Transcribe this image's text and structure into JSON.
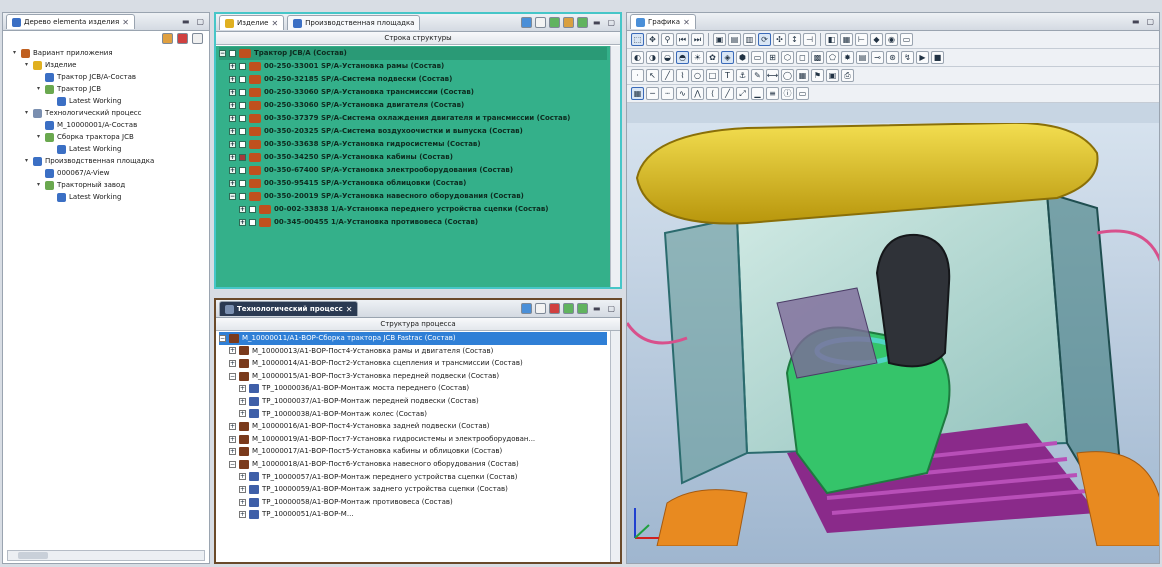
{
  "left_panel": {
    "tab_label": "Дерево elementa изделия",
    "tree": [
      {
        "level": 0,
        "label": "Вариант приложения",
        "expander": "▾",
        "color": "#c06020"
      },
      {
        "level": 1,
        "label": "Изделие",
        "expander": "▾",
        "color": "#e0b020"
      },
      {
        "level": 2,
        "label": "Трактор JCB/A-Состав",
        "expander": "",
        "color": "#3b6fc4"
      },
      {
        "level": 2,
        "label": "Трактор JCB",
        "expander": "▾",
        "color": "#6aa84f"
      },
      {
        "level": 3,
        "label": "Latest Working",
        "expander": "",
        "color": "#3b6fc4"
      },
      {
        "level": 1,
        "label": "Технологический процесс",
        "expander": "▾",
        "color": "#7a8fb0"
      },
      {
        "level": 2,
        "label": "M_10000001/A-Состав",
        "expander": "",
        "color": "#3b6fc4"
      },
      {
        "level": 2,
        "label": "Сборка трактора JCB",
        "expander": "▾",
        "color": "#6aa84f"
      },
      {
        "level": 3,
        "label": "Latest Working",
        "expander": "",
        "color": "#3b6fc4"
      },
      {
        "level": 1,
        "label": "Производственная площадка",
        "expander": "▾",
        "color": "#3b6fc4"
      },
      {
        "level": 2,
        "label": "000067/A-View",
        "expander": "",
        "color": "#3b6fc4"
      },
      {
        "level": 2,
        "label": "Тракторный завод",
        "expander": "▾",
        "color": "#6aa84f"
      },
      {
        "level": 3,
        "label": "Latest Working",
        "expander": "",
        "color": "#3b6fc4"
      }
    ]
  },
  "structure_panel": {
    "tabs": [
      {
        "label": "Изделие",
        "active": true
      },
      {
        "label": "Производственная площадка",
        "active": false
      }
    ],
    "column_header": "Строка структуры",
    "rows": [
      {
        "indent": 0,
        "expander": "−",
        "checked": false,
        "label": "Трактор JCB/A (Состав)",
        "selected": true
      },
      {
        "indent": 1,
        "expander": "+",
        "checked": false,
        "label": "00-250-33001 SP/A-Установка рамы (Состав)"
      },
      {
        "indent": 1,
        "expander": "+",
        "checked": false,
        "label": "00-250-32185 SP/A-Система подвески (Состав)"
      },
      {
        "indent": 1,
        "expander": "+",
        "checked": false,
        "label": "00-250-33060 SP/A-Установка трансмиссии (Состав)"
      },
      {
        "indent": 1,
        "expander": "+",
        "checked": false,
        "label": "00-250-33060 SP/A-Установка двигателя (Состав)"
      },
      {
        "indent": 1,
        "expander": "+",
        "checked": false,
        "label": "00-350-37379 SP/A-Система охлаждения двигателя и трансмиссии (Состав)"
      },
      {
        "indent": 1,
        "expander": "+",
        "checked": false,
        "label": "00-350-20325 SP/A-Система воздухоочистки и выпуска (Состав)"
      },
      {
        "indent": 1,
        "expander": "+",
        "checked": false,
        "label": "00-350-33638 SP/A-Установка гидросистемы (Состав)"
      },
      {
        "indent": 1,
        "expander": "+",
        "checked": true,
        "label": "00-350-34250 SP/A-Установка кабины (Состав)"
      },
      {
        "indent": 1,
        "expander": "+",
        "checked": false,
        "label": "00-350-67400 SP/A-Установка электрооборудования (Состав)"
      },
      {
        "indent": 1,
        "expander": "+",
        "checked": false,
        "label": "00-350-95415 SP/A-Установка облицовки (Состав)"
      },
      {
        "indent": 1,
        "expander": "−",
        "checked": false,
        "label": "00-350-20019 SP/A-Установка навесного оборудования (Состав)"
      },
      {
        "indent": 2,
        "expander": "+",
        "checked": false,
        "label": "00-002-33838 1/A-Установка переднего устройства сцепки (Состав)"
      },
      {
        "indent": 2,
        "expander": "+",
        "checked": false,
        "label": "00-345-00455 1/A-Установка противовеса (Состав)"
      }
    ]
  },
  "process_panel": {
    "tab_label": "Технологический процесс",
    "column_header": "Структура процесса",
    "rows": [
      {
        "indent": 0,
        "expander": "−",
        "kind": "m",
        "label": "M_10000011/A1-ВОР-Сборка трактора JCB Fastrac (Состав)",
        "selected": true
      },
      {
        "indent": 1,
        "expander": "+",
        "kind": "m",
        "label": "M_10000013/A1-ВОР-Пост4-Установка рамы и двигателя (Состав)"
      },
      {
        "indent": 1,
        "expander": "+",
        "kind": "m",
        "label": "M_10000014/A1-ВОР-Пост2-Установка сцепления и трансмиссии (Состав)"
      },
      {
        "indent": 1,
        "expander": "−",
        "kind": "m",
        "label": "M_10000015/A1-ВОР-Пост3-Установка передней подвески (Состав)"
      },
      {
        "indent": 2,
        "expander": "+",
        "kind": "tp",
        "label": "TP_10000036/A1-ВОР-Монтаж моста переднего (Состав)"
      },
      {
        "indent": 2,
        "expander": "+",
        "kind": "tp",
        "label": "TP_10000037/A1-ВОР-Монтаж передней подвески (Состав)"
      },
      {
        "indent": 2,
        "expander": "+",
        "kind": "tp",
        "label": "TP_10000038/A1-ВОР-Монтаж колес (Состав)"
      },
      {
        "indent": 1,
        "expander": "+",
        "kind": "m",
        "label": "M_10000016/A1-ВОР-Пост4-Установка задней подвески (Состав)"
      },
      {
        "indent": 1,
        "expander": "+",
        "kind": "m",
        "label": "M_10000019/A1-ВОР-Пост7-Установка гидросистемы и электрооборудован..."
      },
      {
        "indent": 1,
        "expander": "+",
        "kind": "m",
        "label": "M_10000017/A1-ВОР-Пост5-Установка кабины и облицовки (Состав)"
      },
      {
        "indent": 1,
        "expander": "−",
        "kind": "m",
        "label": "M_10000018/A1-ВОР-Пост6-Установка навесного оборудования (Состав)"
      },
      {
        "indent": 2,
        "expander": "+",
        "kind": "tp",
        "label": "TP_10000057/A1-ВОР-Монтаж переднего устройства сцепки (Состав)"
      },
      {
        "indent": 2,
        "expander": "+",
        "kind": "tp",
        "label": "TP_10000059/A1-ВОР-Монтаж заднего устройства сцепки (Состав)"
      },
      {
        "indent": 2,
        "expander": "+",
        "kind": "tp",
        "label": "TP_10000058/A1-ВОР-Монтаж противовеса (Состав)"
      },
      {
        "indent": 2,
        "expander": "+",
        "kind": "tp",
        "label": "TP_10000051/A1-ВОР-М..."
      }
    ]
  },
  "graphics_panel": {
    "tab_label": "Графика",
    "colors": {
      "roof": "#e8c820",
      "glass": "#b8ded4",
      "frame": "#2b6b6e",
      "seat": "#2f3238",
      "console": "#35c46a",
      "floor": "#8a2a8a",
      "fenders": "#e88a20",
      "background_top": "#d6e2ee",
      "background_bottom": "#9fb6cf"
    }
  }
}
